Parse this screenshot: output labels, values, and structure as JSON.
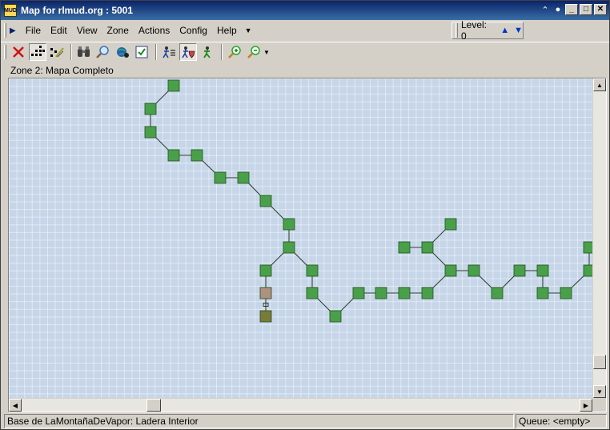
{
  "window": {
    "app_icon_text": "MUD",
    "title": "Map for rlmud.org : 5001"
  },
  "menu": {
    "items": [
      "File",
      "Edit",
      "View",
      "Zone",
      "Actions",
      "Config",
      "Help"
    ]
  },
  "level": {
    "label": "Level: 0"
  },
  "toolbar": {
    "tools": [
      "delete-icon",
      "grid-dots-icon",
      "path-edit-icon",
      "binoculars-icon",
      "magnifier-icon",
      "globe-search-icon",
      "check-box-icon",
      "speedwalk-icon",
      "walker-shield-icon",
      "walker-icon",
      "zoom-in-icon",
      "zoom-out-icon"
    ]
  },
  "zone": {
    "label": "Zone 2: Mapa Completo"
  },
  "map": {
    "room_color": "#4aa04a",
    "current_room_color": "#b09080",
    "special_room_color": "#7a7a3a"
  },
  "status": {
    "location": "Base de LaMontañaDeVapor: Ladera Interior",
    "queue": "Queue:  <empty>"
  }
}
